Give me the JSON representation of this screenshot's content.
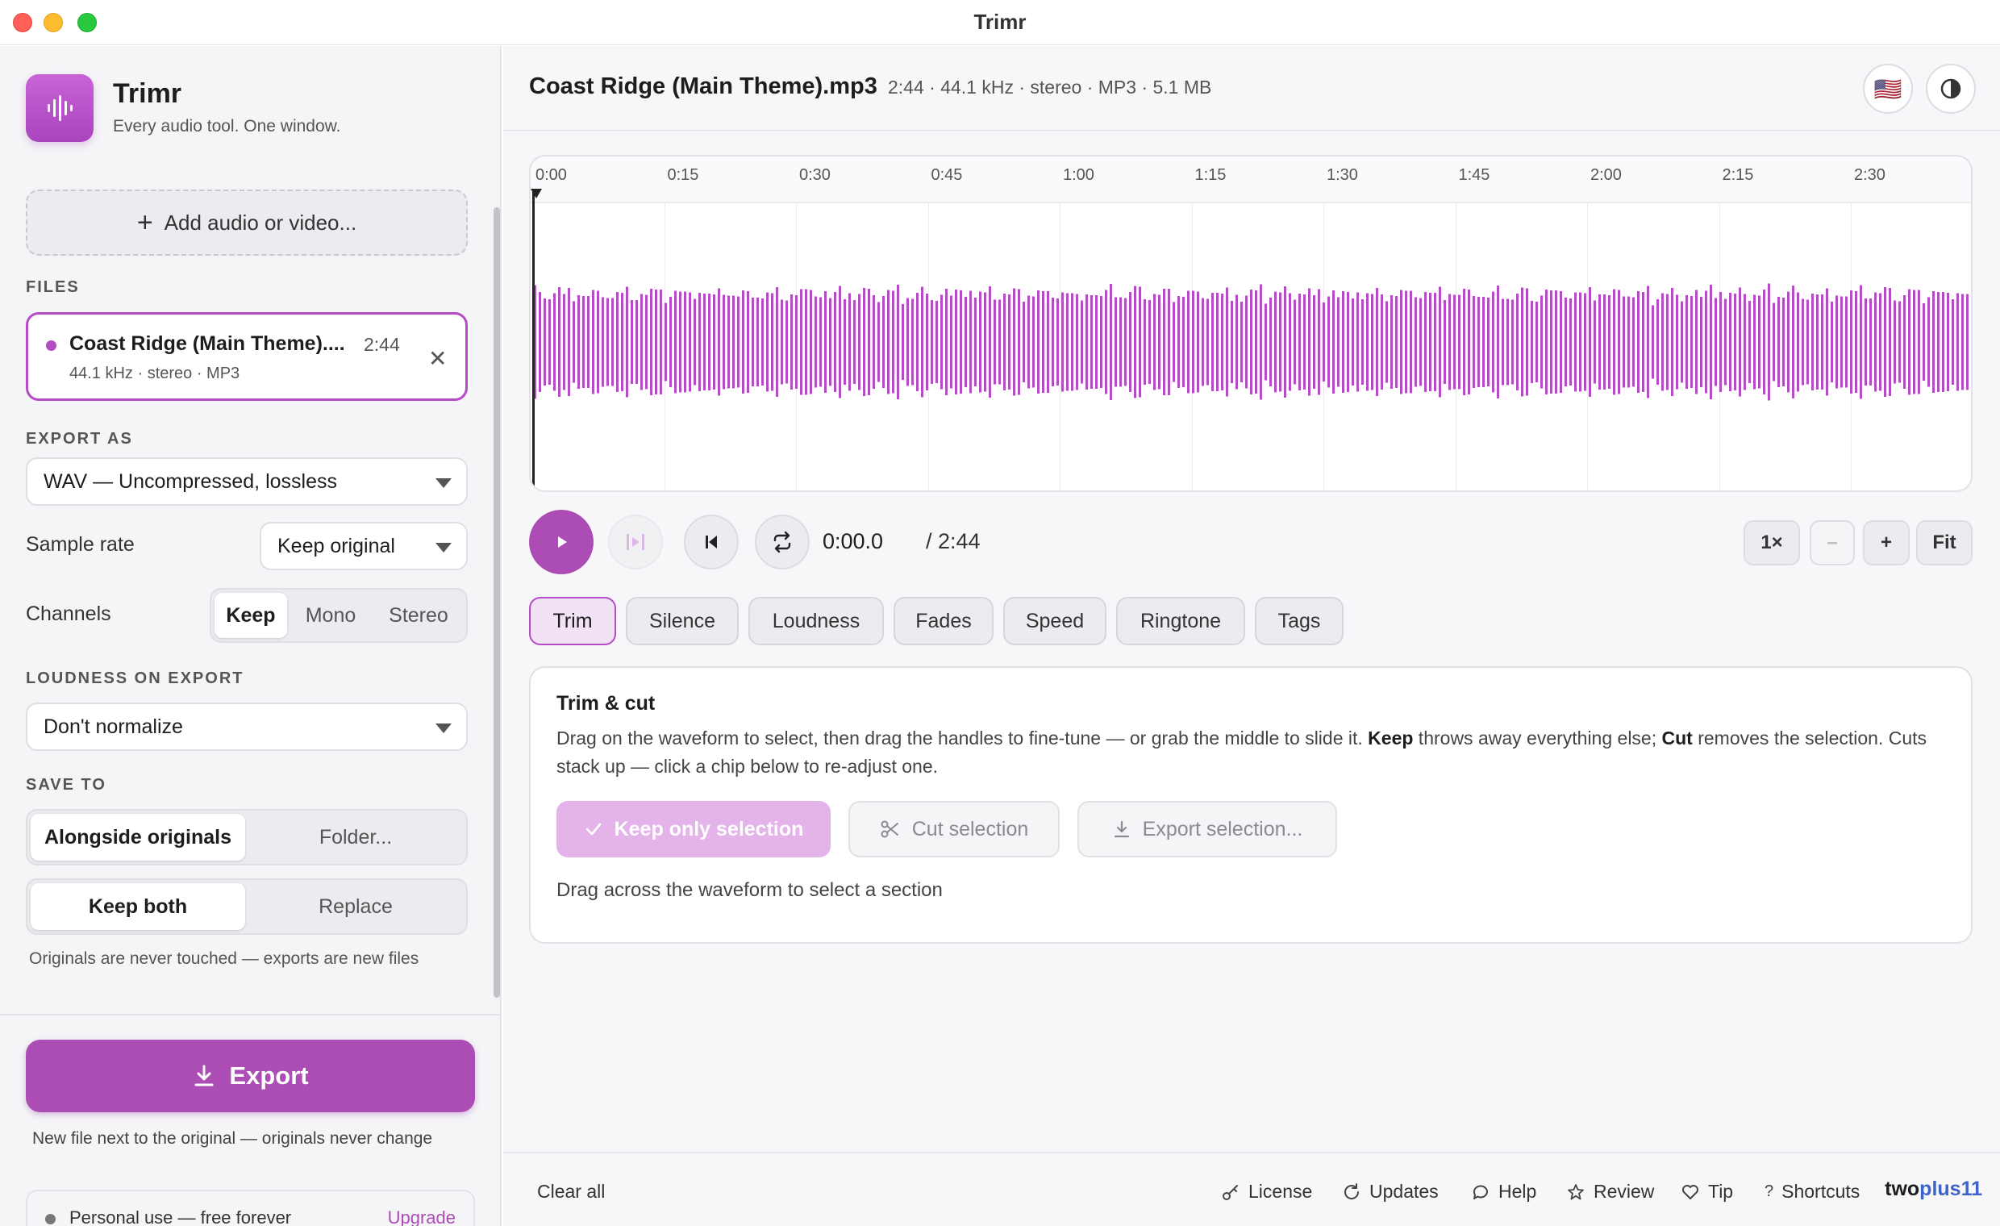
{
  "window": {
    "title": "Trimr"
  },
  "app": {
    "name": "Trimr",
    "tagline": "Every audio tool. One window."
  },
  "sidebar": {
    "add_button": "Add audio or video...",
    "files_label": "FILES",
    "file": {
      "name": "Coast Ridge (Main Theme)....",
      "duration": "2:44",
      "meta": "44.1 kHz · stereo · MP3"
    },
    "export_label": "EXPORT AS",
    "export_format": "WAV — Uncompressed, lossless",
    "sample_rate_label": "Sample rate",
    "sample_rate_value": "Keep original",
    "channels_label": "Channels",
    "channels_options": [
      "Keep",
      "Mono",
      "Stereo"
    ],
    "loudness_label": "LOUDNESS ON EXPORT",
    "loudness_value": "Don't normalize",
    "save_label": "SAVE TO",
    "save_options": [
      "Alongside originals",
      "Folder..."
    ],
    "conflict_options": [
      "Keep both",
      "Replace"
    ],
    "save_note": "Originals are never touched — exports are new files",
    "export_button": "Export",
    "export_note": "New file next to the original — originals never change",
    "license_text": "Personal use — free forever",
    "upgrade": "Upgrade"
  },
  "main": {
    "file_title": "Coast Ridge (Main Theme).mp3",
    "file_meta": "2:44 · 44.1 kHz · stereo · MP3 · 5.1 MB",
    "flag": "🇺🇸",
    "ruler_ticks": [
      "0:00",
      "0:15",
      "0:30",
      "0:45",
      "1:00",
      "1:15",
      "1:30",
      "1:45",
      "2:00",
      "2:15",
      "2:30"
    ],
    "time_current": "0:00.0",
    "time_total": "/ 2:44",
    "zoom": {
      "speed": "1×",
      "minus": "–",
      "plus": "+",
      "fit": "Fit"
    },
    "tabs": [
      "Trim",
      "Silence",
      "Loudness",
      "Fades",
      "Speed",
      "Ringtone",
      "Tags"
    ],
    "trim": {
      "title": "Trim & cut",
      "desc_1": "Drag on the waveform to select, then drag the handles to fine-tune — or grab the middle to slide it. ",
      "desc_keep": "Keep",
      "desc_2": " throws away everything else; ",
      "desc_cut": "Cut",
      "desc_3": " removes the selection. Cuts stack up — click a chip below to re-adjust one.",
      "keep_button": "Keep only selection",
      "cut_button": "Cut selection",
      "export_button": "Export selection...",
      "hint": "Drag across the waveform to select a section"
    }
  },
  "footer": {
    "clear_all": "Clear all",
    "links": [
      "License",
      "Updates",
      "Help",
      "Review",
      "Tip",
      "Shortcuts"
    ],
    "brand_1": "two",
    "brand_2": "plus11"
  },
  "colors": {
    "accent": "#ac4db5",
    "waveform": "#b44cc4",
    "brand_blue": "#3d63c9"
  }
}
